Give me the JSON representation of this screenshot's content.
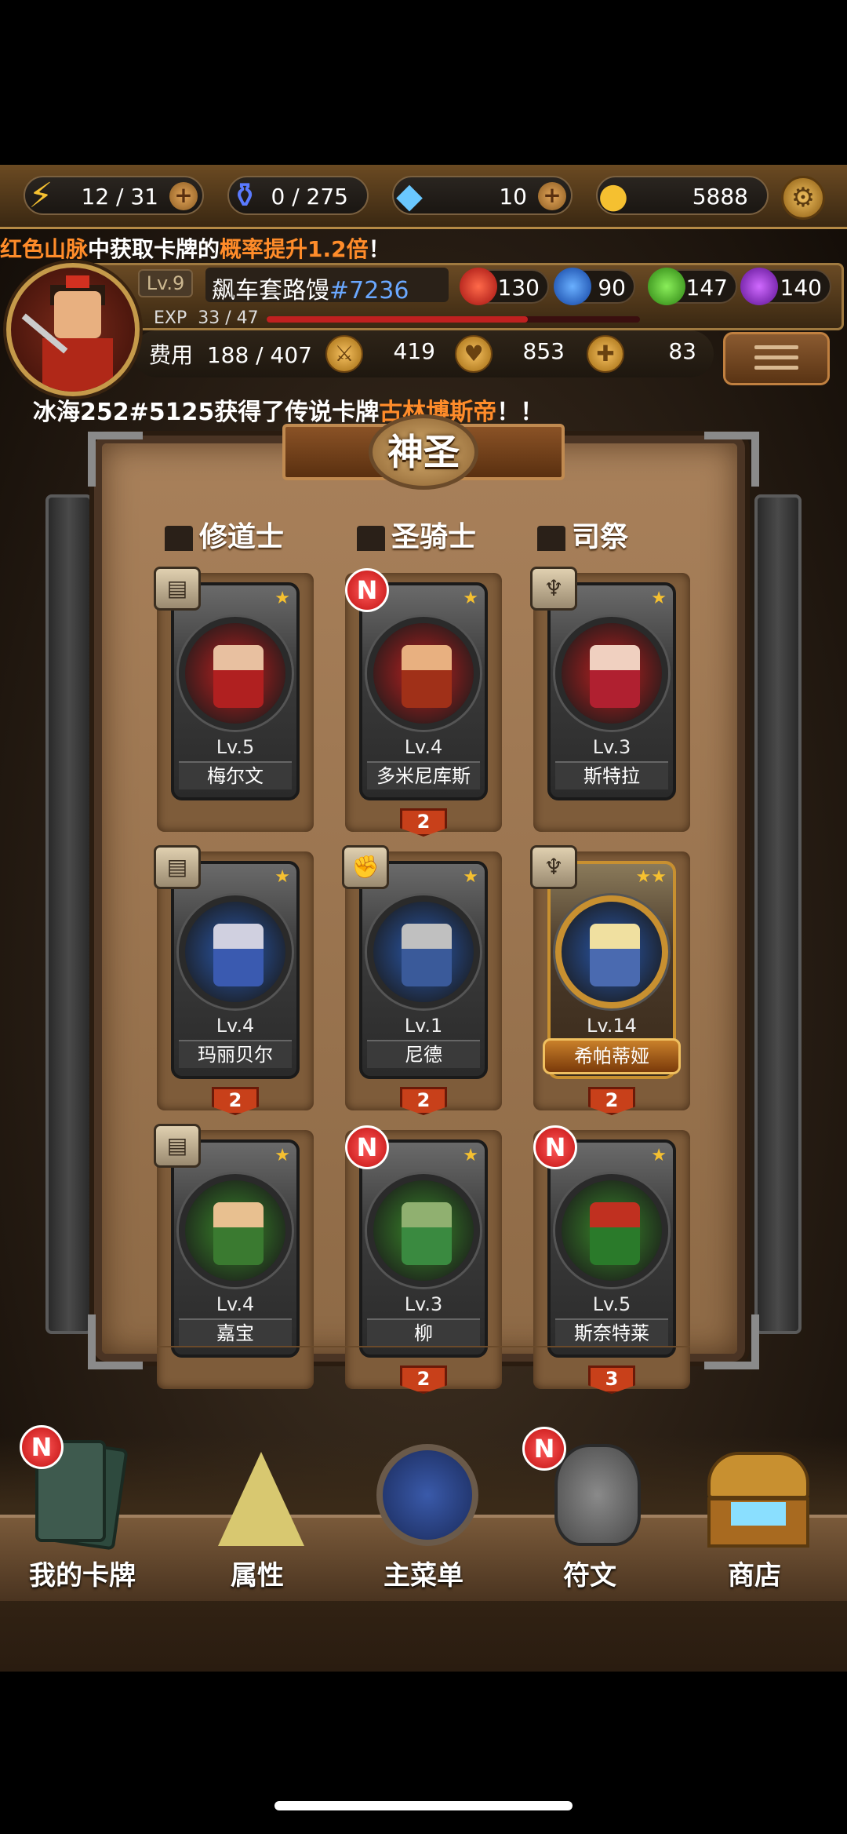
{
  "resources": {
    "energy": "12 / 31",
    "potion": "0 / 275",
    "diamond": "10",
    "gold": "5888"
  },
  "ticker_top": {
    "part1": "红色山脉",
    "part2": "中获取卡牌的",
    "part3": "概率提升1.2倍",
    "part4": "！"
  },
  "player": {
    "level": "Lv.9",
    "name": "飙车套路馒",
    "tag": "#7236",
    "exp_label": "EXP",
    "exp": "33 / 47",
    "exp_fraction": 0.7,
    "gems": {
      "red": "130",
      "blue": "90",
      "green": "147",
      "purple": "140"
    },
    "cost_label": "费用",
    "cost": "188 / 407",
    "attack": "419",
    "health": "853",
    "heal": "83"
  },
  "ticker_bottom": {
    "part1": "冰海252#5125获得了传说卡牌",
    "part2": "古林博斯帝",
    "part3": "！！"
  },
  "board": {
    "title": "神圣",
    "columns": [
      "修道士",
      "圣骑士",
      "司祭"
    ]
  },
  "cards": [
    {
      "lv": "Lv.5",
      "name": "梅尔文",
      "stars": "★",
      "new": "",
      "class_icon": "book-icon",
      "count": ""
    },
    {
      "lv": "Lv.4",
      "name": "多米尼库斯",
      "stars": "★",
      "new": "N",
      "class_icon": "",
      "count": "2"
    },
    {
      "lv": "Lv.3",
      "name": "斯特拉",
      "stars": "★",
      "new": "",
      "class_icon": "wings-icon",
      "count": ""
    },
    {
      "lv": "Lv.4",
      "name": "玛丽贝尔",
      "stars": "★",
      "new": "",
      "class_icon": "book-icon",
      "count": "2"
    },
    {
      "lv": "Lv.1",
      "name": "尼德",
      "stars": "★",
      "new": "",
      "class_icon": "fist-icon",
      "count": "2"
    },
    {
      "lv": "Lv.14",
      "name": "希帕蒂娅",
      "stars": "★★",
      "new": "",
      "class_icon": "wings-icon",
      "count": "2"
    },
    {
      "lv": "Lv.4",
      "name": "嘉宝",
      "stars": "★",
      "new": "",
      "class_icon": "book-icon",
      "count": ""
    },
    {
      "lv": "Lv.3",
      "name": "柳",
      "stars": "★",
      "new": "N",
      "class_icon": "",
      "count": "2"
    },
    {
      "lv": "Lv.5",
      "name": "斯奈特莱",
      "stars": "★",
      "new": "N",
      "class_icon": "",
      "count": "3"
    }
  ],
  "nav": [
    {
      "label": "我的卡牌",
      "new": "N"
    },
    {
      "label": "属性",
      "new": ""
    },
    {
      "label": "主菜单",
      "new": ""
    },
    {
      "label": "符文",
      "new": "N"
    },
    {
      "label": "商店",
      "new": ""
    }
  ],
  "colors": {
    "highlight_orange": "#ff8c2a",
    "tag_blue": "#6aa8ff",
    "badge_red": "#e02020"
  }
}
